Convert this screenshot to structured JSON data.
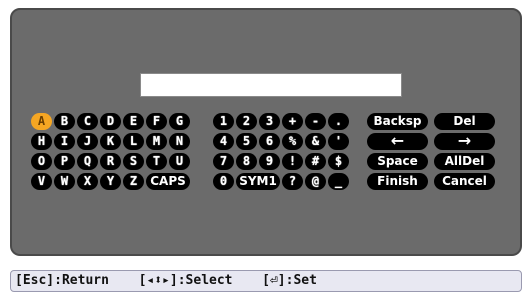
{
  "input": {
    "value": ""
  },
  "keyboard": {
    "selected_key": "A",
    "rows": [
      [
        "A",
        "B",
        "C",
        "D",
        "E",
        "F",
        "G",
        "1",
        "2",
        "3",
        "+",
        "-",
        "."
      ],
      [
        "H",
        "I",
        "J",
        "K",
        "L",
        "M",
        "N",
        "4",
        "5",
        "6",
        "%",
        "&",
        "'"
      ],
      [
        "O",
        "P",
        "Q",
        "R",
        "S",
        "T",
        "U",
        "7",
        "8",
        "9",
        "!",
        "#",
        "$"
      ],
      [
        "V",
        "W",
        "X",
        "Y",
        "Z",
        "CAPS",
        "0",
        "SYM1",
        "?",
        "@",
        "_"
      ]
    ],
    "commands": {
      "backsp": "Backsp",
      "del": "Del",
      "left_arrow": "←",
      "right_arrow": "→",
      "space": "Space",
      "alldel": "AllDel",
      "finish": "Finish",
      "cancel": "Cancel"
    }
  },
  "statusbar": {
    "return": "[Esc]:Return",
    "select": "[◂⬍▸]:Select",
    "set": "[⏎]:Set"
  },
  "colors": {
    "panel": "#6b6b6b",
    "key": "#000000",
    "selected_key": "#f5a623",
    "statusbar": "#e8e8f2"
  }
}
